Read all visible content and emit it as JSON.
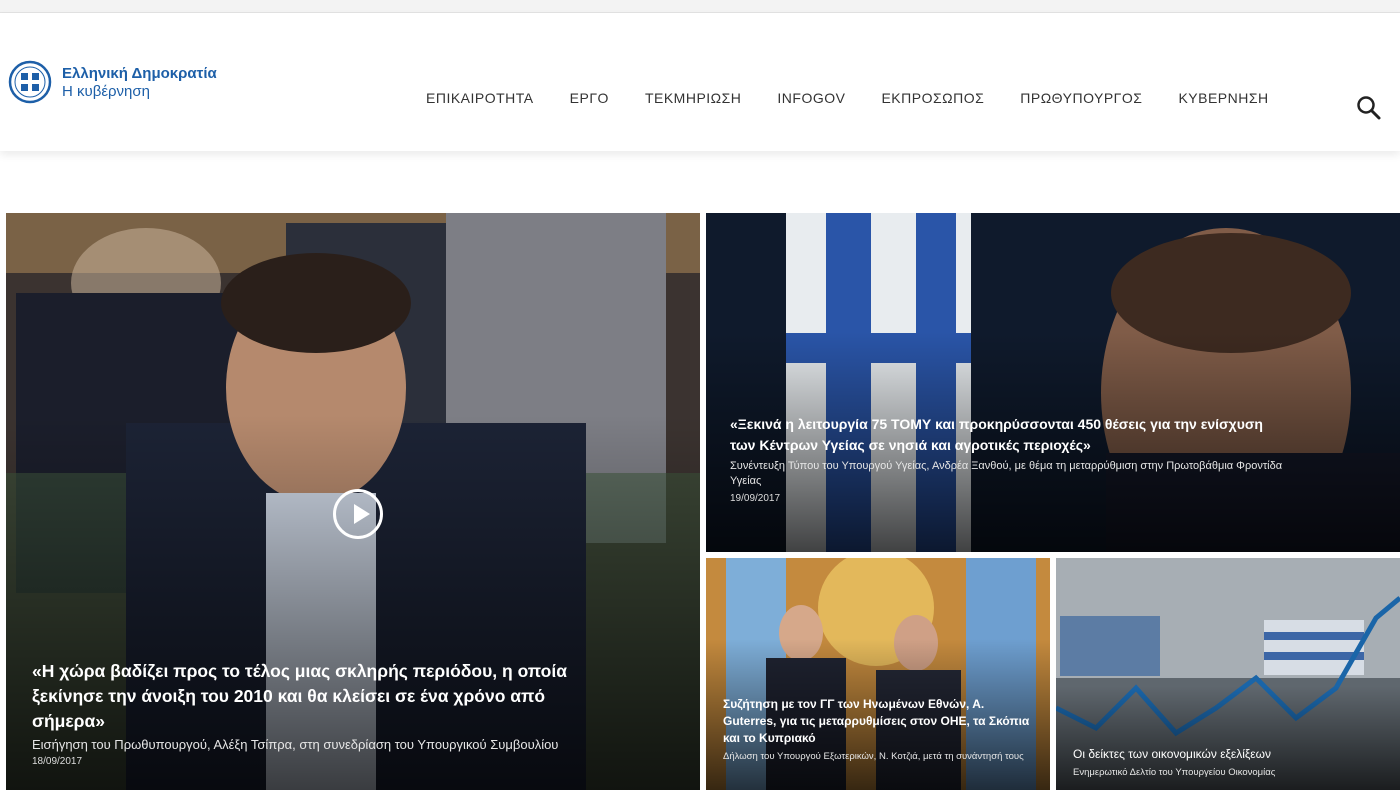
{
  "site": {
    "logo_line1": "Ελληνική Δημοκρατία",
    "logo_line2": "Η κυβέρνηση"
  },
  "nav": {
    "items": [
      "ΕΠΙΚΑΙΡΟΤΗΤΑ",
      "ΕΡΓΟ",
      "ΤΕΚΜΗΡΙΩΣΗ",
      "INFOGOV",
      "ΕΚΠΡΟΣΩΠΟΣ",
      "ΠΡΩΘΥΠΟΥΡΓΟΣ",
      "ΚΥΒΕΡΝΗΣΗ"
    ],
    "search_icon": "search-icon"
  },
  "tiles": [
    {
      "title": "«Η χώρα βαδίζει προς το τέλος μιας σκληρής περιόδου, η οποία ξεκίνησε την άνοιξη του 2010 και θα κλείσει σε ένα χρόνο από σήμερα»",
      "subtitle": "Εισήγηση του Πρωθυπουργού, Αλέξη Τσίπρα, στη συνεδρίαση του Υπουργικού Συμβουλίου",
      "date": "18/09/2017",
      "icon": "play-icon"
    },
    {
      "title": "«Ξεκινά η λειτουργία 75 ΤΟΜΥ και προκηρύσσονται 450 θέσεις για την ενίσχυση των Κέντρων Υγείας σε νησιά και αγροτικές περιοχές»",
      "subtitle": "Συνέντευξη Τύπου του Υπουργού Υγείας, Ανδρέα Ξανθού, με θέμα τη μεταρρύθμιση στην Πρωτοβάθμια Φροντίδα Υγείας",
      "date": "19/09/2017"
    },
    {
      "title": "Συζήτηση με τον ΓΓ των Ηνωμένων Εθνών, Α. Guterres, για τις μεταρρυθμίσεις στον ΟΗΕ, τα Σκόπια και το Κυπριακό",
      "subtitle": "Δήλωση του Υπουργού Εξωτερικών, Ν. Κοτζιά, μετά τη συνάντησή τους"
    },
    {
      "title": "Οι δείκτες των οικονομικών εξελίξεων",
      "subtitle": "Ενημερωτικό Δελτίο του Υπουργείου Οικονομίας"
    }
  ],
  "colors": {
    "brand": "#1d5fa8",
    "nav_text": "#333333",
    "caption_text": "#ffffff"
  }
}
